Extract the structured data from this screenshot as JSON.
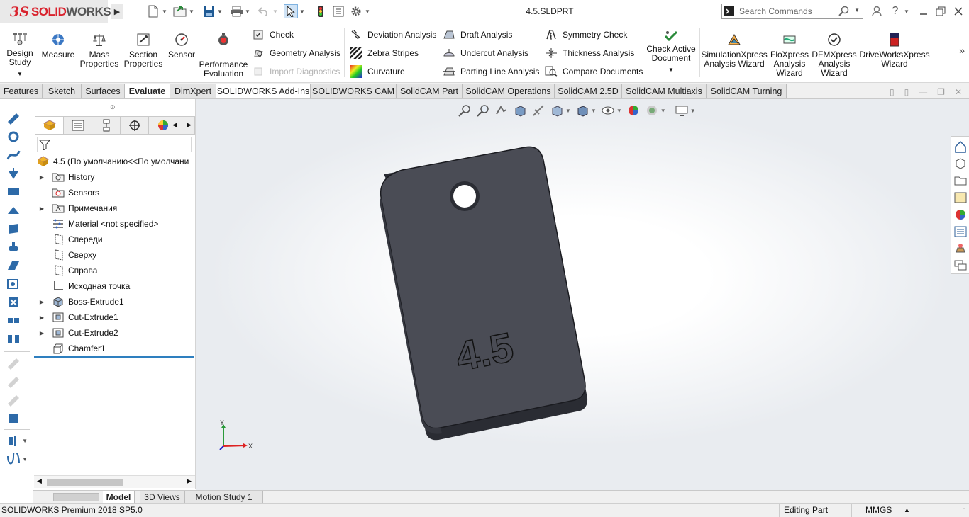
{
  "app": {
    "logo_ds": "3S",
    "logo_solid": "SOLID",
    "logo_works": "WORKS",
    "document_title": "4.5.SLDPRT",
    "search_placeholder": "Search Commands",
    "help_label": "?"
  },
  "ribbon": {
    "design_study": "Design Study",
    "measure": "Measure",
    "mass_properties": "Mass Properties",
    "section_properties": "Section Properties",
    "sensor": "Sensor",
    "performance_evaluation": "Performance Evaluation",
    "check": "Check",
    "geometry_analysis": "Geometry Analysis",
    "import_diagnostics": "Import Diagnostics",
    "deviation_analysis": "Deviation Analysis",
    "zebra_stripes": "Zebra Stripes",
    "curvature": "Curvature",
    "draft_analysis": "Draft Analysis",
    "undercut_analysis": "Undercut Analysis",
    "parting_line_analysis": "Parting Line Analysis",
    "symmetry_check": "Symmetry Check",
    "thickness_analysis": "Thickness Analysis",
    "compare_documents": "Compare Documents",
    "check_active_document": "Check Active Document",
    "simulationxpress": "SimulationXpress Analysis Wizard",
    "floxpress": "FloXpress Analysis Wizard",
    "dfmxpress": "DFMXpress Analysis Wizard",
    "driveworksxpress": "DriveWorksXpress Wizard"
  },
  "tabs": [
    "Features",
    "Sketch",
    "Surfaces",
    "Evaluate",
    "DimXpert",
    "SOLIDWORKS Add-Ins",
    "SOLIDWORKS CAM",
    "SolidCAM Part",
    "SolidCAM Operations",
    "SolidCAM 2.5D",
    "SolidCAM Multiaxis",
    "SolidCAM Turning"
  ],
  "tree": {
    "root": "4.5  (По умолчанию<<По умолчани",
    "items": [
      "History",
      "Sensors",
      "Примечания",
      "Material <not specified>",
      "Спереди",
      "Сверху",
      "Справа",
      "Исходная точка",
      "Boss-Extrude1",
      "Cut-Extrude1",
      "Cut-Extrude2",
      "Chamfer1"
    ]
  },
  "model": {
    "engraving": "4.5",
    "color_body": "#4a4c55"
  },
  "triad": {
    "x": "X",
    "y": "Y"
  },
  "bottom_tabs": [
    "Model",
    "3D Views",
    "Motion Study 1"
  ],
  "status": {
    "product": "SOLIDWORKS Premium 2018 SP5.0",
    "mode": "Editing Part",
    "units": "MMGS"
  }
}
